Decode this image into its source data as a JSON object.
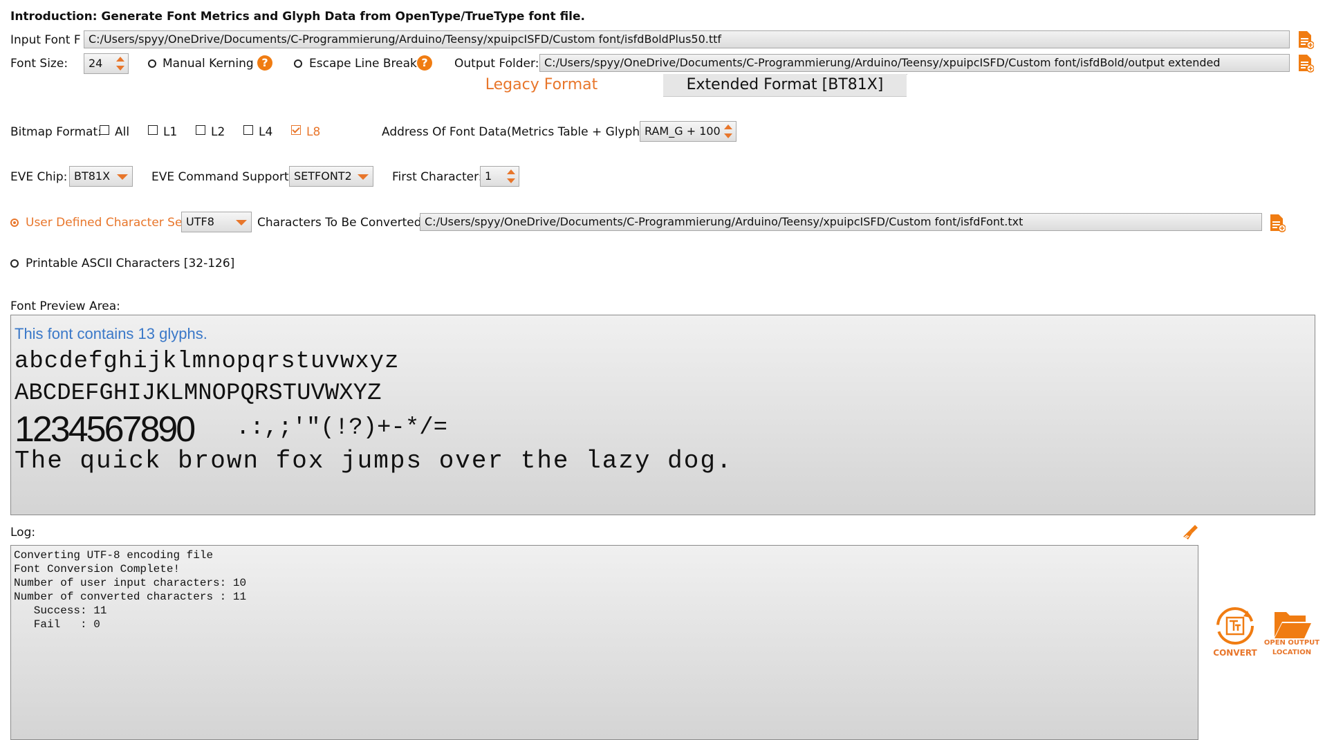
{
  "intro": "Introduction: Generate Font Metrics and Glyph Data from OpenType/TrueType font file.",
  "input_font": {
    "label": "Input Font F",
    "value": "C:/Users/spyy/OneDrive/Documents/C-Programmierung/Arduino/Teensy/xpuipcISFD/Custom font/isfdBoldPlus50.ttf"
  },
  "font_size": {
    "label": "Font Size:",
    "value": "24"
  },
  "manual_kerning": {
    "label": "Manual Kerning"
  },
  "escape_line_break": {
    "label": "Escape Line Break"
  },
  "output_folder": {
    "label": "Output Folder:",
    "value": "C:/Users/spyy/OneDrive/Documents/C-Programmierung/Arduino/Teensy/xpuipcISFD/Custom font/isfdBold/output extended"
  },
  "tabs": [
    {
      "label": "Legacy Format",
      "active": true
    },
    {
      "label": "Extended Format [BT81X]",
      "active": false
    }
  ],
  "bitmap": {
    "label": "Bitmap Format:",
    "options": [
      {
        "label": "All",
        "checked": false
      },
      {
        "label": "L1",
        "checked": false
      },
      {
        "label": "L2",
        "checked": false
      },
      {
        "label": "L4",
        "checked": false
      },
      {
        "label": "L8",
        "checked": true
      }
    ]
  },
  "address": {
    "label": "Address Of Font Data(Metrics Table + Glyph):",
    "value": "RAM_G + 100"
  },
  "eve_chip": {
    "label": "EVE Chip:",
    "value": "BT81X"
  },
  "eve_command": {
    "label": "EVE Command Support:",
    "value": "SETFONT2"
  },
  "first_char": {
    "label": "First Character:",
    "value": "1"
  },
  "charset": {
    "user_defined_label": "User Defined Character Set:",
    "encoding": "UTF8",
    "convert_label": "Characters To Be Converted:",
    "convert_value": "C:/Users/spyy/OneDrive/Documents/C-Programmierung/Arduino/Teensy/xpuipcISFD/Custom font/isfdFont.txt",
    "printable_label": "Printable ASCII Characters [32-126]"
  },
  "preview": {
    "label": "Font Preview Area:",
    "info": "This font contains 13 glyphs.",
    "lines": [
      "abcdefghijklmnopqrstuvwxyz",
      "ABCDEFGHIJKLMNOPQRSTUVWXYZ"
    ],
    "digits": "1234567890",
    "symbols": ".:,;'\"(!?)+-*/=",
    "pangram": "The quick brown fox jumps over the lazy dog."
  },
  "log": {
    "label": "Log:",
    "lines": [
      "Converting UTF-8 encoding file",
      "Font Conversion Complete!",
      "Number of user input characters: 10",
      "Number of converted characters : 11",
      "   Success: 11",
      "   Fail   : 0"
    ]
  },
  "actions": {
    "convert": "CONVERT",
    "open_output_1": "OPEN OUTPUT",
    "open_output_2": "LOCATION"
  },
  "colors": {
    "accent": "#e8762b",
    "info_blue": "#3a78c8"
  }
}
